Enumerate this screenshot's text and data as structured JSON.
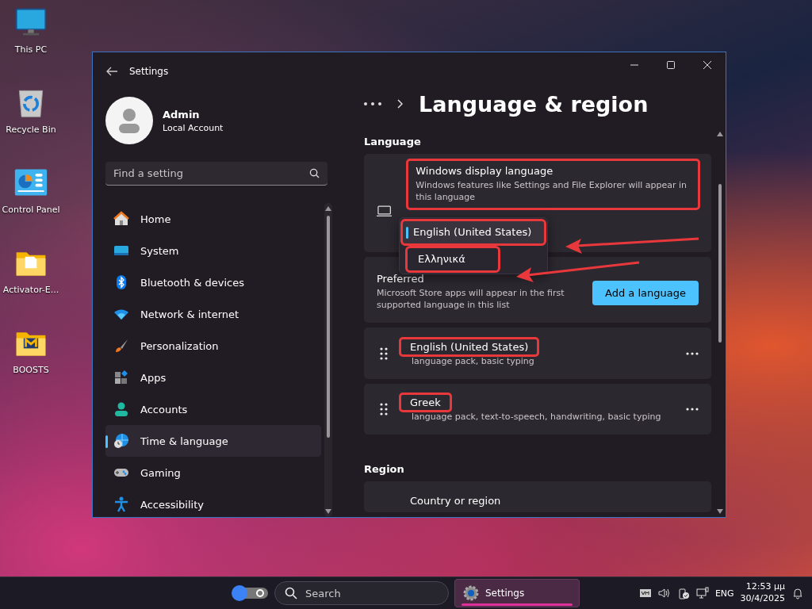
{
  "desktop_icons": [
    {
      "label": "This PC",
      "kind": "pc"
    },
    {
      "label": "Recycle Bin",
      "kind": "bin"
    },
    {
      "label": "Control Panel",
      "kind": "panel"
    },
    {
      "label": "Activator-E...",
      "kind": "folder"
    },
    {
      "label": "BOOSTS",
      "kind": "folder-m"
    }
  ],
  "window": {
    "title": "Settings",
    "user": {
      "name": "Admin",
      "account": "Local Account"
    },
    "search": {
      "placeholder": "Find a setting"
    },
    "nav": [
      {
        "label": "Home",
        "selected": false
      },
      {
        "label": "System",
        "selected": false
      },
      {
        "label": "Bluetooth & devices",
        "selected": false
      },
      {
        "label": "Network & internet",
        "selected": false
      },
      {
        "label": "Personalization",
        "selected": false
      },
      {
        "label": "Apps",
        "selected": false
      },
      {
        "label": "Accounts",
        "selected": false
      },
      {
        "label": "Time & language",
        "selected": true
      },
      {
        "label": "Gaming",
        "selected": false
      },
      {
        "label": "Accessibility",
        "selected": false
      }
    ],
    "page_title": "Language & region",
    "language": {
      "heading": "Language",
      "display_language": {
        "title": "Windows display language",
        "description": "Windows features like Settings and File Explorer will appear in this language",
        "highlighted": true
      },
      "dropdown": [
        {
          "label": "English (United States)",
          "selected": true,
          "highlighted": true
        },
        {
          "label": "Ελληνικά",
          "selected": false,
          "highlighted": true
        }
      ],
      "preferred": {
        "title": "Preferred",
        "description": "Microsoft Store apps will appear in the first supported language in this list",
        "button": "Add a language"
      },
      "languages": [
        {
          "name": "English (United States)",
          "features": "language pack, basic typing",
          "highlighted": true
        },
        {
          "name": "Greek",
          "features": "language pack, text-to-speech, handwriting, basic typing",
          "highlighted": true
        }
      ]
    },
    "region": {
      "heading": "Region",
      "items": [
        {
          "title": "Country or region"
        }
      ]
    }
  },
  "taskbar": {
    "search": {
      "placeholder": "Search"
    },
    "apps": [
      {
        "label": "Settings",
        "selected": true
      }
    ],
    "language": "ENG",
    "time": "12:53 μμ",
    "date": "30/4/2025"
  }
}
